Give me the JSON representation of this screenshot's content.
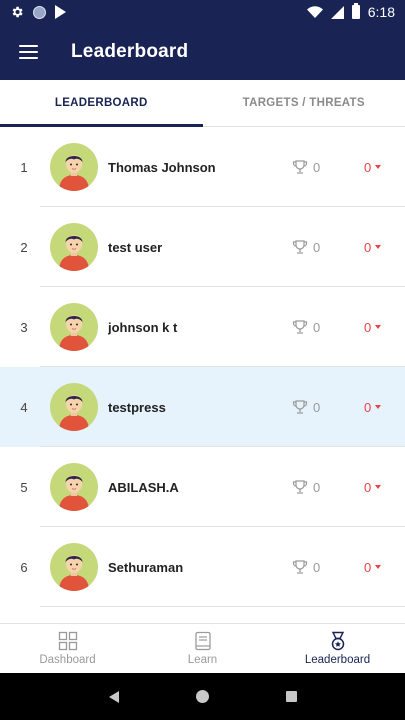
{
  "status_bar": {
    "time": "6:18"
  },
  "app_bar": {
    "title": "Leaderboard",
    "menu_icon": "menu-icon"
  },
  "tabs": [
    {
      "label": "LEADERBOARD",
      "active": true
    },
    {
      "label": "TARGETS / THREATS",
      "active": false
    }
  ],
  "leaderboard": [
    {
      "rank": "1",
      "name": "Thomas Johnson",
      "trophies": "0",
      "change": "0",
      "highlighted": false
    },
    {
      "rank": "2",
      "name": "test user",
      "trophies": "0",
      "change": "0",
      "highlighted": false
    },
    {
      "rank": "3",
      "name": "johnson k t",
      "trophies": "0",
      "change": "0",
      "highlighted": false
    },
    {
      "rank": "4",
      "name": "testpress",
      "trophies": "0",
      "change": "0",
      "highlighted": true
    },
    {
      "rank": "5",
      "name": "ABILASH.A",
      "trophies": "0",
      "change": "0",
      "highlighted": false
    },
    {
      "rank": "6",
      "name": "Sethuraman",
      "trophies": "0",
      "change": "0",
      "highlighted": false
    }
  ],
  "bottom_nav": [
    {
      "label": "Dashboard",
      "icon": "dashboard-icon",
      "active": false
    },
    {
      "label": "Learn",
      "icon": "book-icon",
      "active": false
    },
    {
      "label": "Leaderboard",
      "icon": "medal-icon",
      "active": true
    }
  ],
  "colors": {
    "primary": "#192454",
    "highlight_row": "#e6f2fc",
    "avatar_bg": "#c5d97b",
    "decrease": "#e54545"
  }
}
